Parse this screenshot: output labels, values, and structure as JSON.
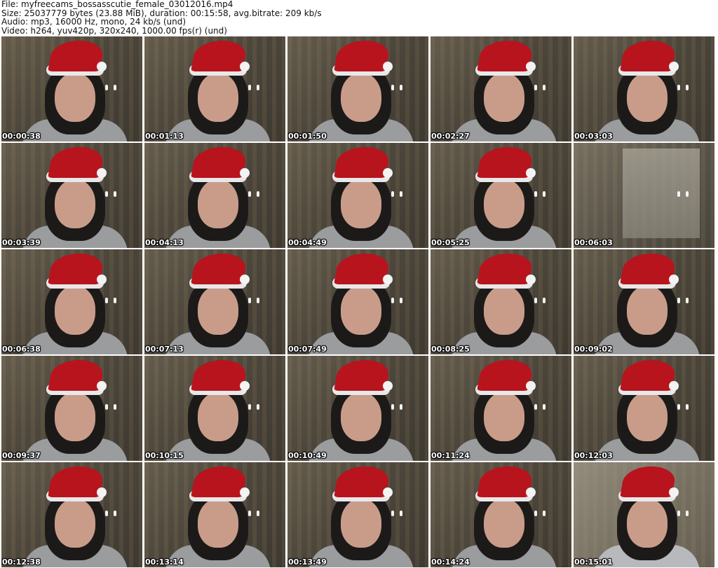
{
  "header": {
    "line1": "File: myfreecams_bossasscutie_female_03012016.mp4",
    "line2": "Size: 25037779 bytes (23.88 MiB), duration: 00:15:58, avg.bitrate: 209 kb/s",
    "line3": "Audio: mp3, 16000 Hz, mono, 24 kb/s (und)",
    "line4": "Video: h264, yuv420p, 320x240, 1000.00 fps(r) (und)"
  },
  "thumbnails": [
    {
      "timestamp": "00:00:38"
    },
    {
      "timestamp": "00:01:13"
    },
    {
      "timestamp": "00:01:50"
    },
    {
      "timestamp": "00:02:27"
    },
    {
      "timestamp": "00:03:03"
    },
    {
      "timestamp": "00:03:39"
    },
    {
      "timestamp": "00:04:13"
    },
    {
      "timestamp": "00:04:49"
    },
    {
      "timestamp": "00:05:25"
    },
    {
      "timestamp": "00:06:03"
    },
    {
      "timestamp": "00:06:38"
    },
    {
      "timestamp": "00:07:13"
    },
    {
      "timestamp": "00:07:49"
    },
    {
      "timestamp": "00:08:25"
    },
    {
      "timestamp": "00:09:02"
    },
    {
      "timestamp": "00:09:37"
    },
    {
      "timestamp": "00:10:15"
    },
    {
      "timestamp": "00:10:49"
    },
    {
      "timestamp": "00:11:24"
    },
    {
      "timestamp": "00:12:03"
    },
    {
      "timestamp": "00:12:38"
    },
    {
      "timestamp": "00:13:14"
    },
    {
      "timestamp": "00:13:49"
    },
    {
      "timestamp": "00:14:24"
    },
    {
      "timestamp": "00:15:01"
    }
  ]
}
